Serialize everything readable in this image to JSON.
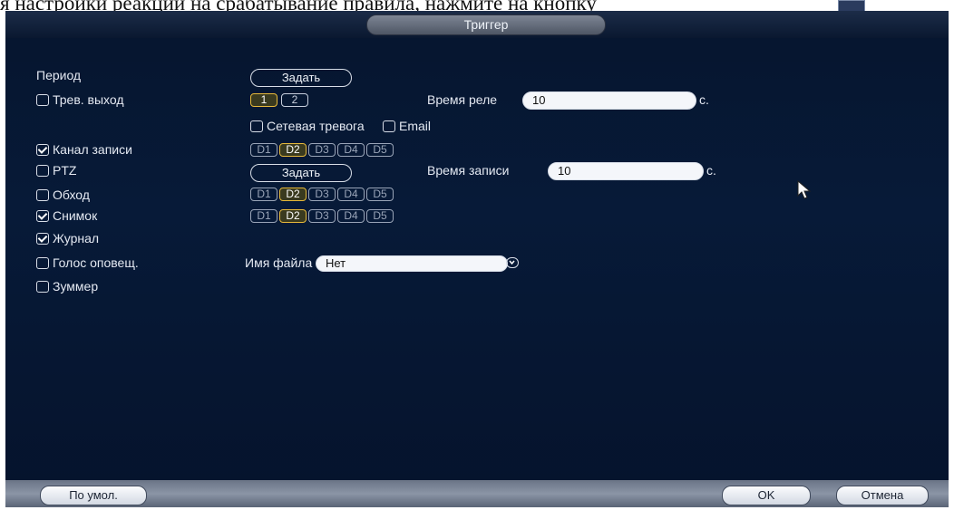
{
  "doc_line_text": "я настройки реакции на срабатывание правила, нажмите на кнопку",
  "title": "Триггер",
  "rows": {
    "period": {
      "label": "Период",
      "button": "Задать"
    },
    "alarm_out": {
      "label": "Трев. выход",
      "checked": false,
      "outputs": [
        "1",
        "2"
      ],
      "relay_label": "Время реле",
      "relay_value": "10",
      "unit": "с."
    },
    "network_alarm": {
      "label": "Сетевая тревога",
      "checked": false
    },
    "email": {
      "label": "Email",
      "checked": false
    },
    "record_channel": {
      "label": "Канал записи",
      "checked": true,
      "channels": [
        "D1",
        "D2",
        "D3",
        "D4",
        "D5"
      ]
    },
    "ptz": {
      "label": "PTZ",
      "checked": false,
      "button": "Задать",
      "record_time_label": "Время записи",
      "record_time_value": "10",
      "unit": "с."
    },
    "tour": {
      "label": "Обход",
      "checked": false,
      "channels": [
        "D1",
        "D2",
        "D3",
        "D4",
        "D5"
      ]
    },
    "snapshot": {
      "label": "Снимок",
      "checked": true,
      "channels": [
        "D1",
        "D2",
        "D3",
        "D4",
        "D5"
      ]
    },
    "log": {
      "label": "Журнал",
      "checked": true
    },
    "voice": {
      "label": "Голос оповещ.",
      "checked": false,
      "file_label": "Имя файла",
      "file_value": "Нет"
    },
    "buzzer": {
      "label": "Зуммер",
      "checked": false
    }
  },
  "footer": {
    "default_label": "По умол.",
    "ok_label": "OK",
    "cancel_label": "Отмена"
  },
  "colors": {
    "background": "#06152e",
    "selected_border": "#e6b93a",
    "text": "#e4e9f2"
  },
  "icons": {
    "dropdown": "chevron-down-icon",
    "cursor": "mouse-pointer-icon"
  }
}
